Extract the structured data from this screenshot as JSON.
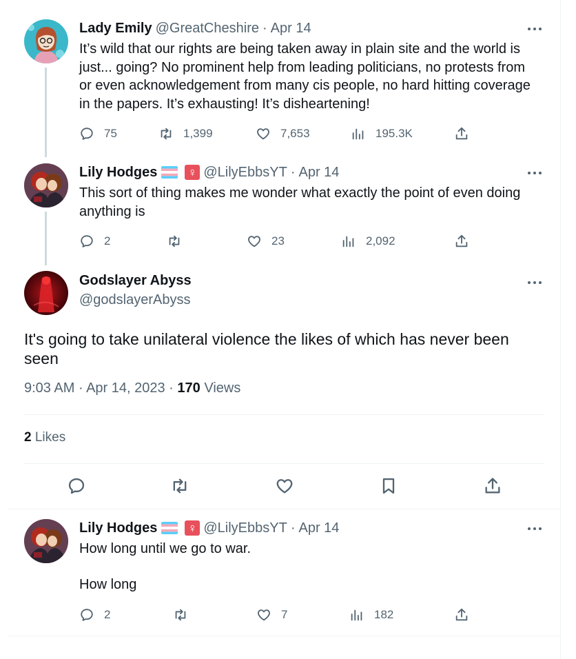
{
  "thread": [
    {
      "name": "Lady Emily",
      "handle": "@GreatCheshire",
      "date": "Apr 14",
      "lines": [
        "It’s wild that our rights are being taken away in plain site and the world is",
        "just... going? No prominent help from leading politicians, no protests from",
        "or even acknowledgement from many cis people, no hard hitting coverage",
        "in the papers. It’s exhausting! It’s disheartening!"
      ],
      "replies": "75",
      "retweets": "1,399",
      "likes": "7,653",
      "views": "195.3K"
    },
    {
      "name": "Lily Hodges",
      "handle": "@LilyEbbsYT",
      "date": "Apr 14",
      "venus": "♀",
      "lines": [
        "This sort of thing makes me wonder what exactly the point of even doing",
        "anything is"
      ],
      "replies": "2",
      "retweets": "",
      "likes": "23",
      "views": "2,092"
    }
  ],
  "main": {
    "name": "Godslayer Abyss",
    "handle": "@godslayerAbyss",
    "lines": [
      "It's going to take unilateral violence the likes of which has never been",
      "seen"
    ],
    "time": "9:03 AM",
    "full_date": "Apr 14, 2023",
    "views_count": "170",
    "views_label": "Views",
    "likes_count": "2",
    "likes_label": "Likes"
  },
  "reply": {
    "name": "Lily Hodges",
    "handle": "@LilyEbbsYT",
    "date": "Apr 14",
    "venus": "♀",
    "line1": "How long until we go to war.",
    "line2": "How long",
    "replies": "2",
    "retweets": "",
    "likes": "7",
    "views": "182"
  },
  "separator": "·",
  "colors": {
    "text": "#0f1419",
    "secondary": "#536471",
    "divider": "#eff3f4",
    "thread_line": "#cfd9de",
    "venus_badge": "#e8505b"
  },
  "icons": [
    "reply-icon",
    "retweet-icon",
    "like-icon",
    "views-icon",
    "share-icon",
    "bookmark-icon",
    "more-icon"
  ]
}
